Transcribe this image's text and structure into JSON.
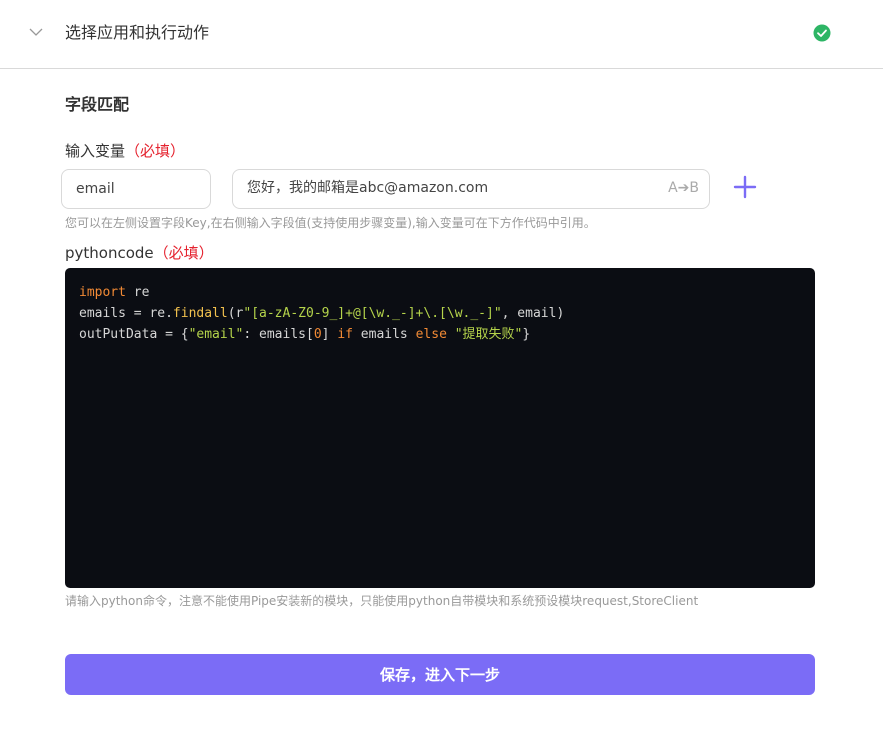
{
  "header": {
    "title": "选择应用和执行动作",
    "status": "complete"
  },
  "section": {
    "title": "字段匹配"
  },
  "input_var": {
    "label": "输入变量",
    "required": "（必填）",
    "key_value": "email",
    "value_text": "您好，我的邮箱是abc@amazon.com",
    "transform_icon": "A➔B",
    "help": "您可以在左侧设置字段Key,在右侧输入字段值(支持使用步骤变量),输入变量可在下方作代码中引用。"
  },
  "python": {
    "label": "pythoncode",
    "required": "（必填）",
    "code_lines": [
      "import re",
      "emails = re.findall(r\"[a-zA-Z0-9_]+@[\\w._-]+\\.[\\w._-]\", email)",
      "outPutData = {\"email\": emails[0] if emails else \"提取失败\"}"
    ],
    "help": "请输入python命令，注意不能使用Pipe安装新的模块，只能使用python自带模块和系统预设模块request,StoreClient"
  },
  "actions": {
    "save_label": "保存，进入下一步"
  },
  "colors": {
    "accent": "#7b6cf6",
    "success": "#2db565",
    "required": "#e5232f",
    "code_bg": "#0b0d13"
  }
}
